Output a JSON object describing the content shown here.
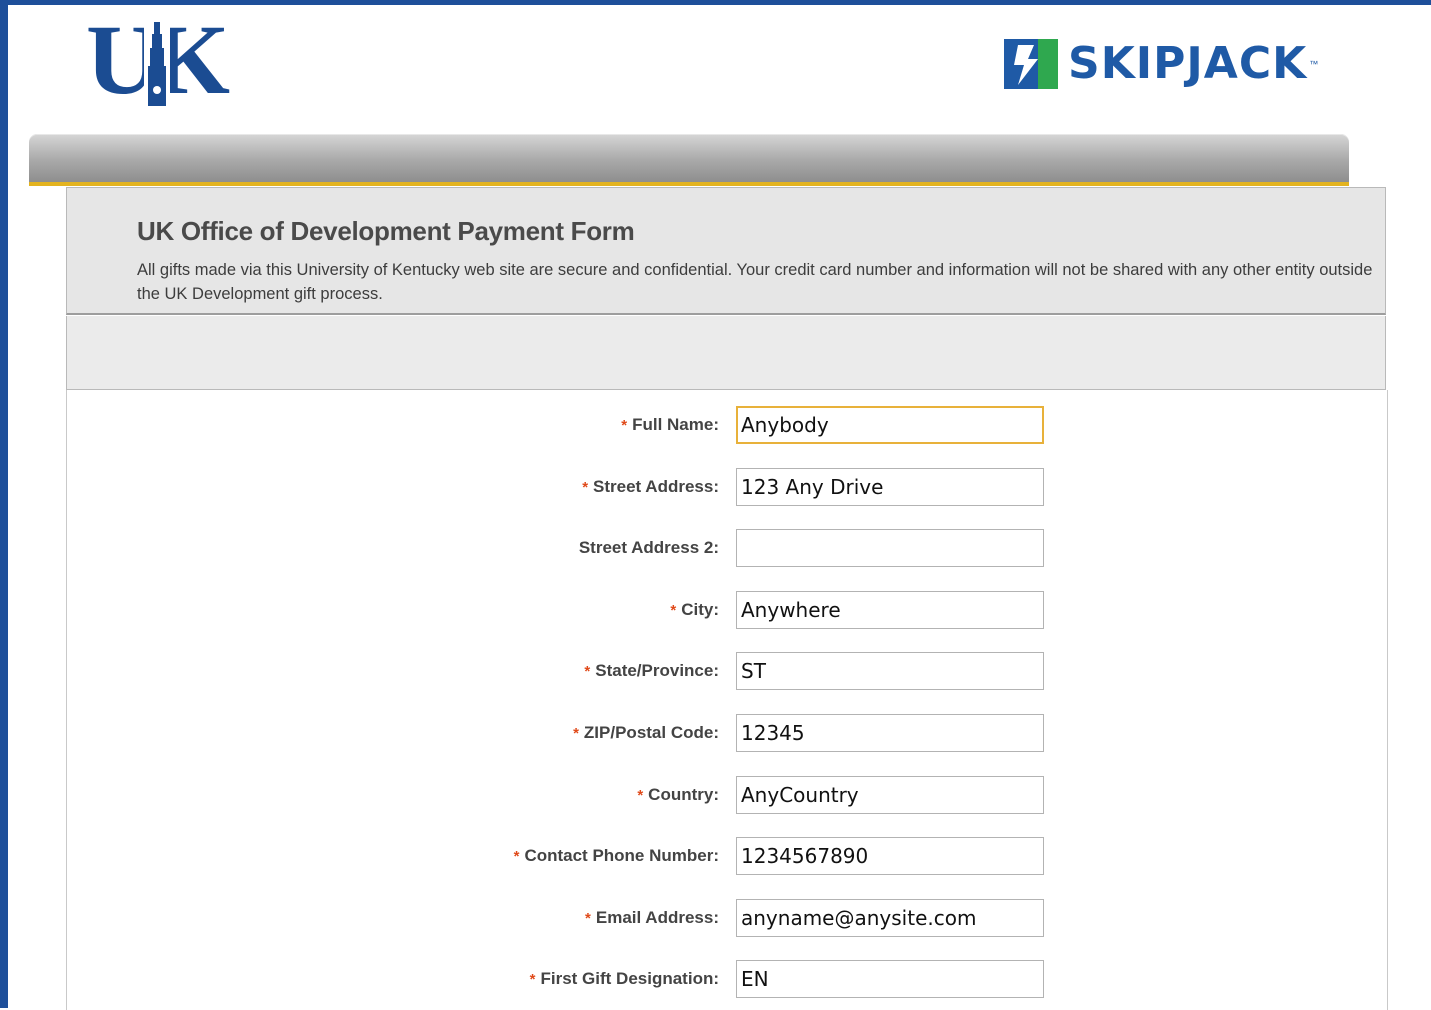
{
  "header": {
    "uk_logo_text": "UK",
    "skipjack_logo_text": "SKIPJACK",
    "skipjack_tm": "™"
  },
  "form": {
    "title": "UK Office of Development Payment Form",
    "description": "All gifts made via this University of Kentucky web site are secure and confidential. Your credit card number and information will not be shared with any other entity outside the UK Development gift process.",
    "required_marker": "*",
    "fields": [
      {
        "label": "Full Name:",
        "value": "Anybody",
        "required": true
      },
      {
        "label": "Street Address:",
        "value": "123 Any Drive",
        "required": true
      },
      {
        "label": "Street Address 2:",
        "value": "",
        "required": false
      },
      {
        "label": "City:",
        "value": "Anywhere",
        "required": true
      },
      {
        "label": "State/Province:",
        "value": "ST",
        "required": true
      },
      {
        "label": "ZIP/Postal Code:",
        "value": "12345",
        "required": true
      },
      {
        "label": "Country:",
        "value": "AnyCountry",
        "required": true
      },
      {
        "label": "Contact Phone Number:",
        "value": "1234567890",
        "required": true
      },
      {
        "label": "Email Address:",
        "value": "anyname@anysite.com",
        "required": true
      },
      {
        "label": "First Gift Designation:",
        "value": "EN",
        "required": true
      }
    ]
  },
  "colors": {
    "frame_blue": "#1e4f9a",
    "uk_blue": "#1b4c92",
    "skipjack_blue": "#1f5aa6",
    "skipjack_green": "#2fa84f",
    "accent_gold": "#e3b31f",
    "required_red": "#e04a1a",
    "focus_border": "#e8b13a"
  }
}
